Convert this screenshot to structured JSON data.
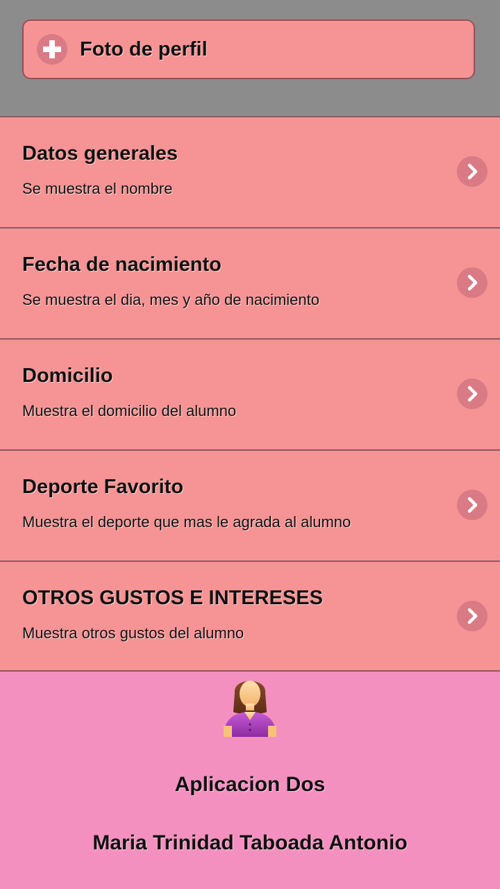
{
  "photo_button": {
    "label": "Foto de perfil",
    "icon": "plus-icon"
  },
  "menu": {
    "items": [
      {
        "title": "Datos generales",
        "description": "Se muestra el nombre",
        "icon": "chevron-right-icon"
      },
      {
        "title": "Fecha de nacimiento",
        "description": "Se muestra el dia, mes y año de nacimiento",
        "icon": "chevron-right-icon"
      },
      {
        "title": "Domicilio",
        "description": "Muestra el domicilio del alumno",
        "icon": "chevron-right-icon"
      },
      {
        "title": "Deporte Favorito",
        "description": "Muestra el deporte que mas le agrada al alumno",
        "icon": "chevron-right-icon"
      },
      {
        "title": "OTROS GUSTOS E INTERESES",
        "description": "Muestra otros gustos del alumno",
        "icon": "chevron-right-icon"
      }
    ]
  },
  "footer": {
    "avatar_icon": "female-user-avatar-icon",
    "app_name": "Aplicacion Dos",
    "author": "Maria Trinidad Taboada Antonio"
  },
  "colors": {
    "header_bg": "#8c8c8c",
    "item_bg": "#f69394",
    "footer_bg": "#f490bf",
    "icon_circle": "#d97a84"
  }
}
